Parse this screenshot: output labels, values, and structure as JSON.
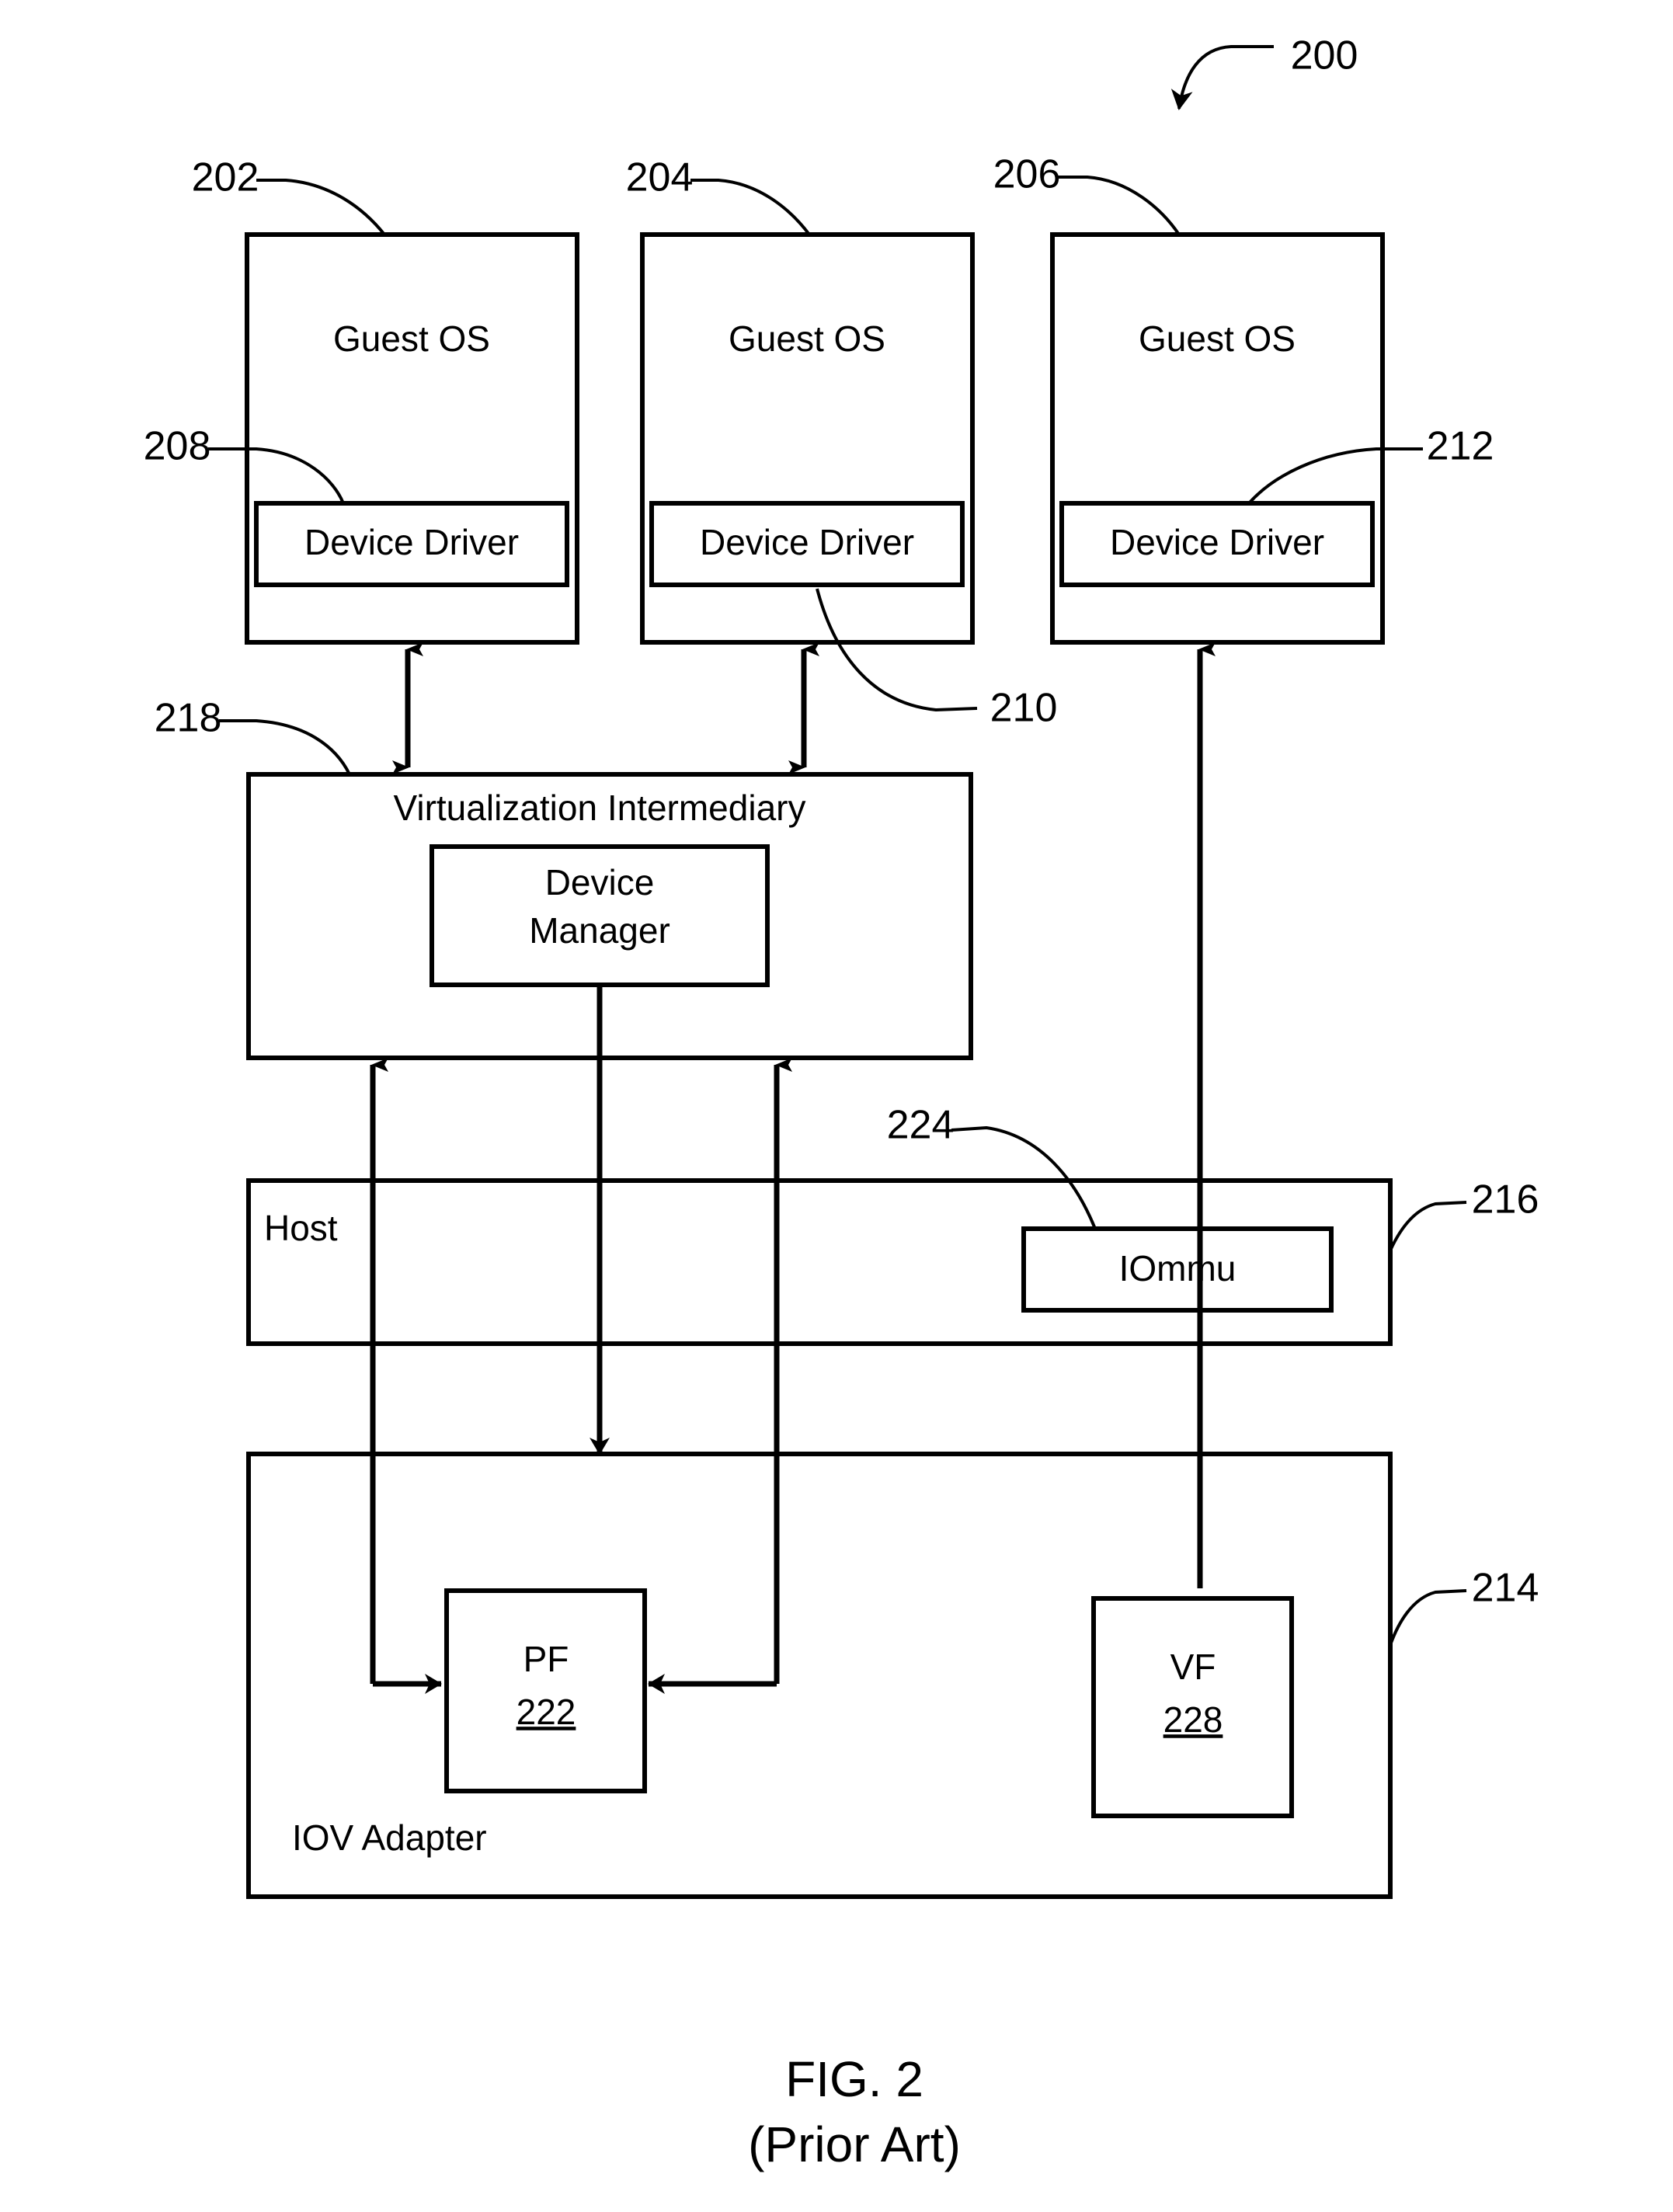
{
  "figure": {
    "caption_line1": "FIG. 2",
    "caption_line2": "(Prior Art)",
    "system_ref": "200"
  },
  "guest_os": [
    {
      "label": "Guest OS",
      "ref": "202",
      "driver_label": "Device Driver",
      "driver_ref": "208"
    },
    {
      "label": "Guest OS",
      "ref": "204",
      "driver_label": "Device Driver",
      "driver_ref": "210"
    },
    {
      "label": "Guest OS",
      "ref": "206",
      "driver_label": "Device Driver",
      "driver_ref": "212"
    }
  ],
  "virtualization_intermediary": {
    "label": "Virtualization Intermediary",
    "ref": "218",
    "device_manager": {
      "line1": "Device",
      "line2": "Manager"
    }
  },
  "host": {
    "label": "Host",
    "ref": "216",
    "iommu": {
      "label": "IOmmu",
      "ref": "224"
    }
  },
  "iov_adapter": {
    "label": "IOV Adapter",
    "ref": "214",
    "pf": {
      "label": "PF",
      "ref": "222"
    },
    "vf": {
      "label": "VF",
      "ref": "228"
    }
  },
  "colors": {
    "stroke": "#000000",
    "background": "#ffffff"
  }
}
